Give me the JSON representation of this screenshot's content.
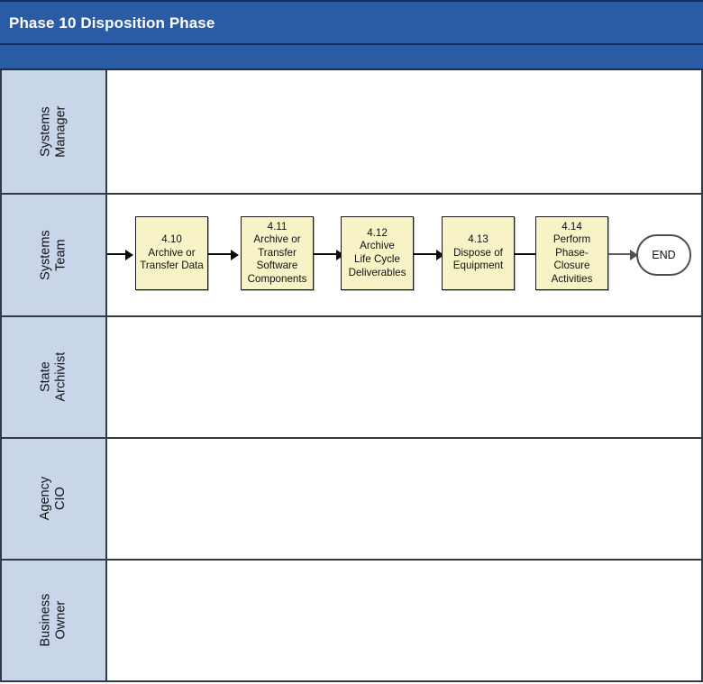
{
  "header": {
    "title": "Phase 10 Disposition Phase",
    "band_color": "#2a5ca5",
    "band_border_color": "#14315c",
    "title_color": "#ffffff"
  },
  "lanes": [
    {
      "id": "systems-manager",
      "label_line1": "Systems",
      "label_line2": "Manager"
    },
    {
      "id": "systems-team",
      "label_line1": "Systems",
      "label_line2": "Team"
    },
    {
      "id": "state-archivist",
      "label_line1": "State",
      "label_line2": "Archivist"
    },
    {
      "id": "agency-cio",
      "label_line1": "Agency",
      "label_line2": "CIO"
    },
    {
      "id": "business-owner",
      "label_line1": "Business",
      "label_line2": "Owner"
    }
  ],
  "lane_style": {
    "label_fill": "#c9d5e8",
    "body_fill": "#ffffff",
    "border_color": "#333a44"
  },
  "process_nodes": [
    {
      "id": "4.10",
      "number": "4.10",
      "title": "Archive or\nTransfer Data",
      "lane": "systems-team"
    },
    {
      "id": "4.11",
      "number": "4.11",
      "title": "Archive or\nTransfer\nSoftware\nComponents",
      "lane": "systems-team"
    },
    {
      "id": "4.12",
      "number": "4.12",
      "title": "Archive\nLife Cycle\nDeliverables",
      "lane": "systems-team"
    },
    {
      "id": "4.13",
      "number": "4.13",
      "title": "Dispose of\nEquipment",
      "lane": "systems-team"
    },
    {
      "id": "4.14",
      "number": "4.14",
      "title": "Perform\nPhase-\nClosure\nActivities",
      "lane": "systems-team"
    }
  ],
  "terminator": {
    "id": "end",
    "label": "END",
    "lane": "systems-team",
    "border_color": "#4f4f4f"
  },
  "node_style": {
    "fill": "#f7f3c6",
    "border": "#1a1a1a",
    "text_color": "#101010"
  },
  "connectors": [
    {
      "id": "entry-to-4.10",
      "from": "lane-edge",
      "to": "4.10",
      "color": "#0a0a0a"
    },
    {
      "id": "4.10-to-4.11",
      "from": "4.10",
      "to": "4.11",
      "color": "#0a0a0a"
    },
    {
      "id": "4.11-to-4.12",
      "from": "4.11",
      "to": "4.12",
      "color": "#0a0a0a"
    },
    {
      "id": "4.12-to-4.13",
      "from": "4.12",
      "to": "4.13",
      "color": "#0a0a0a"
    },
    {
      "id": "4.13-to-4.14",
      "from": "4.13",
      "to": "4.14",
      "color": "#0a0a0a"
    },
    {
      "id": "4.14-to-end",
      "from": "4.14",
      "to": "end",
      "color": "#4f4f4f"
    }
  ]
}
